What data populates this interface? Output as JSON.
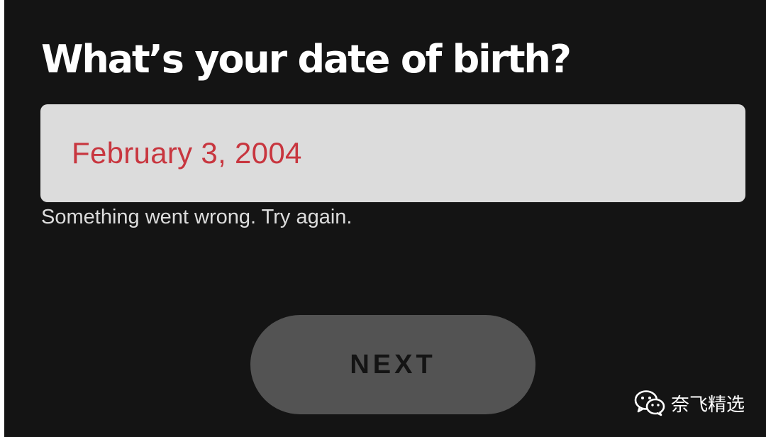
{
  "page": {
    "title": "What’s your date of birth?"
  },
  "date_field": {
    "value": "February 3, 2004",
    "state": "error"
  },
  "error_message": "Something went wrong. Try again.",
  "next_button": {
    "label": "NEXT",
    "enabled": false
  },
  "watermark": {
    "icon": "wechat-icon",
    "text": "奈飞精选"
  },
  "colors": {
    "background": "#141414",
    "field_background": "#dcdcdc",
    "error_text": "#c8363f",
    "button_disabled": "#535353",
    "title_text": "#ffffff"
  }
}
